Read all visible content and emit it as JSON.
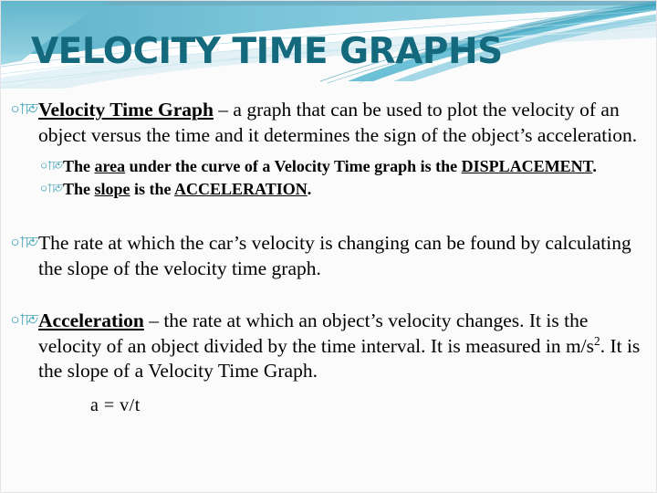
{
  "slide": {
    "title": "VELOCITY TIME GRAPHS",
    "background_color": "#fbfbfc",
    "title_color": "#15697d",
    "bullet_color": "#4aa8b8",
    "bullet_glyph": "আ০"
  },
  "banner": {
    "name": "decorative-wave-banner",
    "colors": {
      "teal_band": "#6ec4d6",
      "deep_teal": "#2a9bb5",
      "pale_teal": "#a9dbe6",
      "ribbon_light": "#c9e9f1",
      "steel": "#79a9bd"
    }
  },
  "body": {
    "b1": {
      "bullet": "আ০",
      "lead": "Velocity Time Graph",
      "rest": " – a graph that can be used to plot the velocity of an object versus the time and it determines the sign of the object’s acceleration."
    },
    "b2": {
      "bullet": "আ০",
      "p1": "The ",
      "u1": "area",
      "p2": " under the curve of a Velocity Time graph is the ",
      "u2": "DISPLACEMENT",
      "p3": "."
    },
    "b3": {
      "bullet": "আ০",
      "p1": "The ",
      "u1": "slope",
      "p2": " is the ",
      "u2": "ACCELERATION",
      "p3": "."
    },
    "b4": {
      "bullet": "আ০",
      "text": "The rate at which the car’s velocity is changing can be found by calculating the slope of the velocity time graph."
    },
    "b5": {
      "bullet": "আ০",
      "lead": "Acceleration",
      "rest_a": " – the rate at which an object’s velocity changes.  It is the velocity of an object divided by the time interval.  It is measured in m/s",
      "sup": "2",
      "rest_b": ".  It is the slope of a Velocity Time Graph."
    },
    "formula": "a = v/t"
  }
}
